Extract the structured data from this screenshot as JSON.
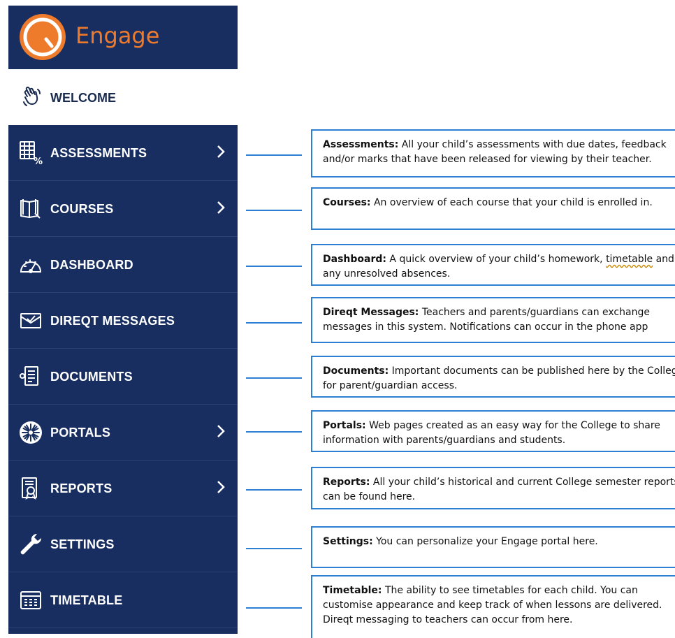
{
  "logo": {
    "text": "Engage",
    "brand_color": "#ee7a2c"
  },
  "welcome": {
    "label": "WELCOME",
    "icon": "waving-hand-icon"
  },
  "nav": [
    {
      "label": "ASSESSMENTS",
      "icon": "assessment-grid-icon",
      "has_chevron": true
    },
    {
      "label": "COURSES",
      "icon": "book-icon",
      "has_chevron": true
    },
    {
      "label": "DASHBOARD",
      "icon": "gauge-icon",
      "has_chevron": false
    },
    {
      "label": "DIREQT MESSAGES",
      "icon": "mail-icon",
      "has_chevron": false
    },
    {
      "label": "DOCUMENTS",
      "icon": "document-icon",
      "has_chevron": false
    },
    {
      "label": "PORTALS",
      "icon": "portal-burst-icon",
      "has_chevron": true
    },
    {
      "label": "REPORTS",
      "icon": "report-badge-icon",
      "has_chevron": true
    },
    {
      "label": "SETTINGS",
      "icon": "wrench-icon",
      "has_chevron": false
    },
    {
      "label": "TIMETABLE",
      "icon": "calendar-grid-icon",
      "has_chevron": false
    }
  ],
  "descriptions": [
    {
      "term": "Assessments:",
      "text": " All your child’s assessments with due dates, feedback and/or marks that have been released for viewing by their teacher."
    },
    {
      "term": "Courses:",
      "text": " An overview of each course that your child is enrolled in."
    },
    {
      "term": "Dashboard:",
      "text_before": " A quick overview of your child’s homework, ",
      "underlined": "timetable",
      "text_after": " and any unresolved absences."
    },
    {
      "term": "Direqt Messages:",
      "text": " Teachers and parents/guardians can exchange messages in this system. Notifications can occur in the phone app"
    },
    {
      "term": "Documents:",
      "text": " Important documents can be published here by the College for parent/guardian access."
    },
    {
      "term": "Portals:",
      "text": " Web pages created as an easy way for the College to share information with parents/guardians and students."
    },
    {
      "term": "Reports:",
      "text": " All your child’s historical and current College semester reports can be found here."
    },
    {
      "term": "Settings:",
      "text": " You can personalize your Engage portal here."
    },
    {
      "term": "Timetable:",
      "text": " The ability to see timetables for each child. You can customise appearance and keep track of when lessons are delivered. Direqt messaging to teachers can occur from here."
    }
  ],
  "colors": {
    "sidebar": "#182e60",
    "connector": "#2d7fd2",
    "brand": "#ee7a2c"
  }
}
